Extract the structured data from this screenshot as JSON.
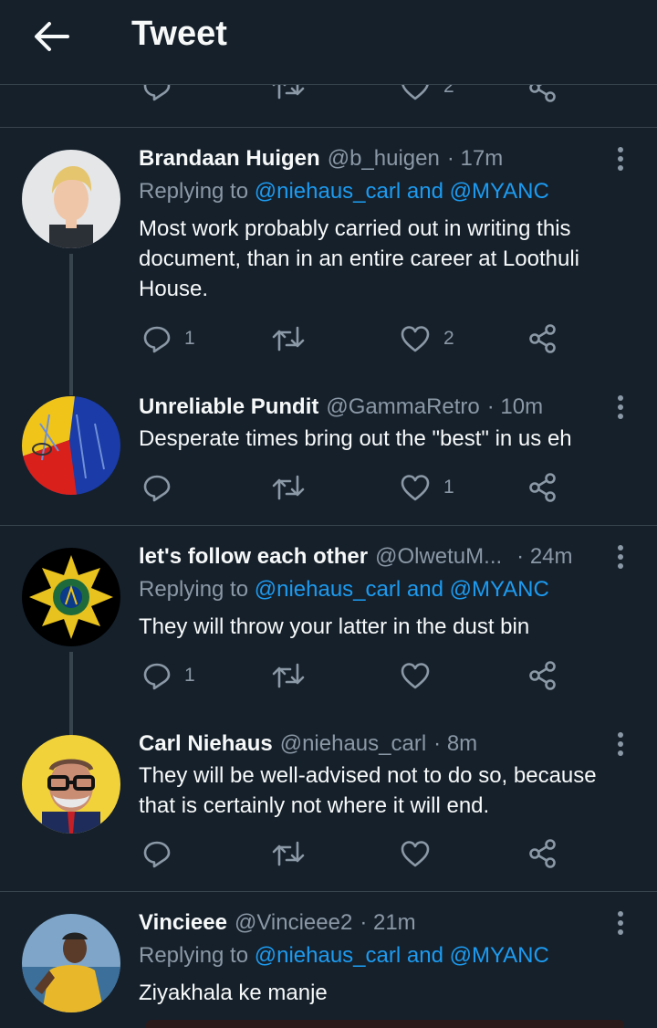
{
  "header": {
    "title": "Tweet",
    "back_icon": "arrow-left-icon"
  },
  "previous_tweet_actions": {
    "like_count": "2"
  },
  "tweets": [
    {
      "display_name": "Brandaan Huigen",
      "handle": "@b_huigen",
      "time": "· 17m",
      "replying_prefix": "Replying to",
      "replying_mentions": "@niehaus_carl and @MYANC",
      "lines": [
        "Most work probably carried out in writing this",
        "document, than in an entire career at Loothuli",
        "House."
      ],
      "reply_count": "1",
      "retweet_count": "",
      "like_count": "2"
    },
    {
      "display_name": "Unreliable Pundit",
      "handle": "@GammaRetro",
      "time": "· 10m",
      "lines": [
        "Desperate times bring out the \"best\" in us eh"
      ],
      "reply_count": "",
      "retweet_count": "",
      "like_count": "1"
    },
    {
      "display_name": "let's follow each other",
      "handle": "@OlwetuM...",
      "time": "· 24m",
      "replying_prefix": "Replying to",
      "replying_mentions": "@niehaus_carl and @MYANC",
      "lines": [
        "They will throw your latter in the dust bin"
      ],
      "reply_count": "1",
      "retweet_count": "",
      "like_count": ""
    },
    {
      "display_name": "Carl Niehaus",
      "handle": "@niehaus_carl",
      "time": "· 8m",
      "lines": [
        "They will be well-advised not to do so, because",
        "that is certainly not where it will end."
      ],
      "reply_count": "",
      "retweet_count": "",
      "like_count": ""
    },
    {
      "display_name": "Vincieee",
      "handle": "@Vincieee2",
      "time": "· 21m",
      "replying_prefix": "Replying to",
      "replying_mentions": "@niehaus_carl and @MYANC",
      "lines": [
        "Ziyakhala ke manje"
      ]
    }
  ],
  "colors": {
    "background": "#15202b",
    "divider": "#38444d",
    "text": "#f7f9f9",
    "muted": "#8b98a5",
    "accent": "#1d9bf0"
  }
}
